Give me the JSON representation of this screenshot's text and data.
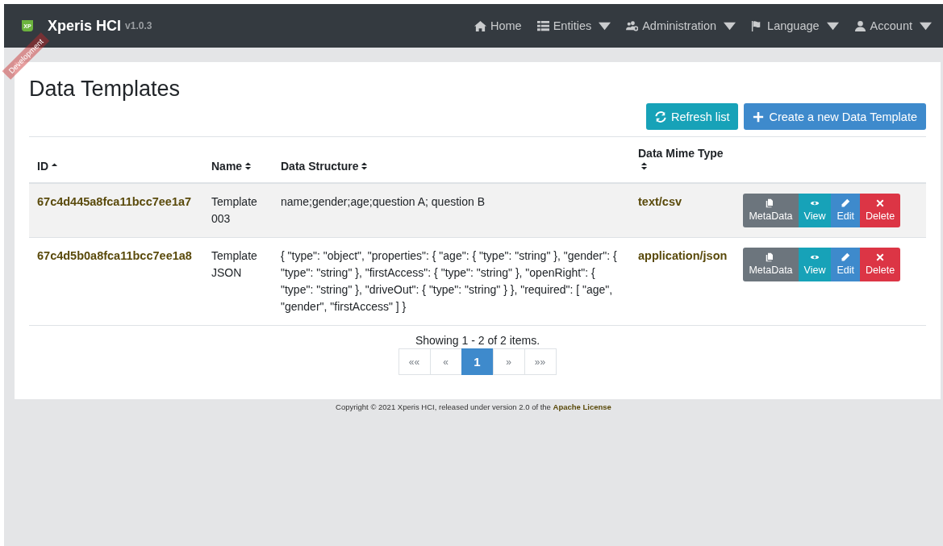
{
  "navbar": {
    "brand": "Xperis HCI",
    "version": "v1.0.3",
    "logo_text": "XP",
    "ribbon": "Development",
    "items": [
      {
        "label": "Home",
        "dropdown": false
      },
      {
        "label": "Entities",
        "dropdown": true
      },
      {
        "label": "Administration",
        "dropdown": true
      },
      {
        "label": "Language",
        "dropdown": true
      },
      {
        "label": "Account",
        "dropdown": true
      }
    ]
  },
  "page": {
    "title": "Data Templates",
    "buttons": [
      {
        "label": "Refresh list",
        "kind": "refresh"
      },
      {
        "label": "Create a new Data Template",
        "kind": "create"
      }
    ]
  },
  "table": {
    "columns": [
      {
        "label": "ID"
      },
      {
        "label": "Name"
      },
      {
        "label": "Data Structure"
      },
      {
        "label": "Data Mime Type"
      }
    ],
    "rows": [
      {
        "id": "67c4d445a8fca11bcc7ee1a7",
        "name": "Template 003",
        "structure": "name;gender;age;question A; question B",
        "mime": "text/csv",
        "actions": [
          "MetaData",
          "View",
          "Edit",
          "Delete"
        ]
      },
      {
        "id": "67c4d5b0a8fca11bcc7ee1a8",
        "name": "Template JSON",
        "structure": "{ \"type\": \"object\", \"properties\": { \"age\": { \"type\": \"string\" }, \"gender\": { \"type\": \"string\" }, \"firstAccess\": { \"type\": \"string\" }, \"openRight\": { \"type\": \"string\" }, \"driveOut\": { \"type\": \"string\" } }, \"required\": [ \"age\", \"gender\", \"firstAccess\" ] }",
        "mime": "application/json",
        "actions": [
          "MetaData",
          "View",
          "Edit",
          "Delete"
        ]
      }
    ]
  },
  "pagination": {
    "summary": "Showing 1 - 2 of 2 items.",
    "pages": [
      {
        "label": "««",
        "selected": false
      },
      {
        "label": "«",
        "selected": false
      },
      {
        "label": "1",
        "selected": true
      },
      {
        "label": "»",
        "selected": false
      },
      {
        "label": "»»",
        "selected": false
      }
    ]
  },
  "footer": {
    "text": "Copyright © 2021 Xperis HCI, released under version 2.0 of the",
    "link": "Apache License"
  }
}
